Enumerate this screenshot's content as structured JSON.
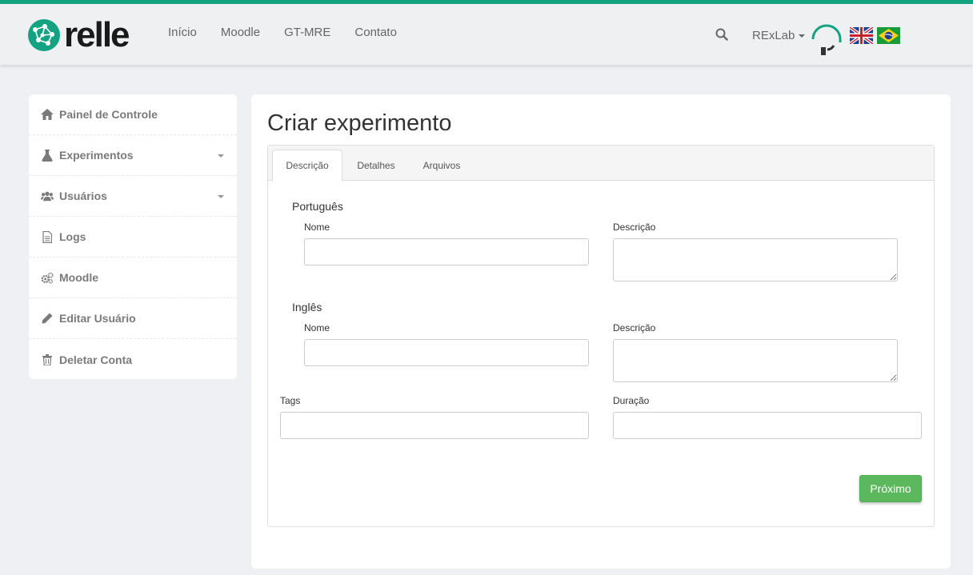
{
  "header": {
    "logo_text": "relle",
    "nav": [
      "Início",
      "Moodle",
      "GT-MRE",
      "Contato"
    ],
    "user_menu_label": "RExLab",
    "accent_color": "#13a383"
  },
  "sidebar": {
    "items": [
      {
        "label": "Painel de Controle",
        "icon": "home-icon"
      },
      {
        "label": "Experimentos",
        "icon": "flask-icon"
      },
      {
        "label": "Usuários",
        "icon": "users-icon"
      },
      {
        "label": "Logs",
        "icon": "document-icon"
      },
      {
        "label": "Moodle",
        "icon": "gears-icon"
      },
      {
        "label": "Editar Usuário",
        "icon": "pencil-icon"
      },
      {
        "label": "Deletar Conta",
        "icon": "trash-icon"
      }
    ]
  },
  "main": {
    "title": "Criar experimento",
    "tabs": [
      "Descrição",
      "Detalhes",
      "Arquivos"
    ],
    "portuguese": {
      "section": "Português",
      "name_label": "Nome",
      "desc_label": "Descrição",
      "name_value": "",
      "desc_value": ""
    },
    "english": {
      "section": "Inglês",
      "name_label": "Nome",
      "desc_label": "Descrição",
      "name_value": "",
      "desc_value": ""
    },
    "tags_label": "Tags",
    "tags_value": "",
    "duration_label": "Duração",
    "duration_value": "",
    "next_button": "Próximo",
    "next_button_color": "#5cb85c"
  }
}
